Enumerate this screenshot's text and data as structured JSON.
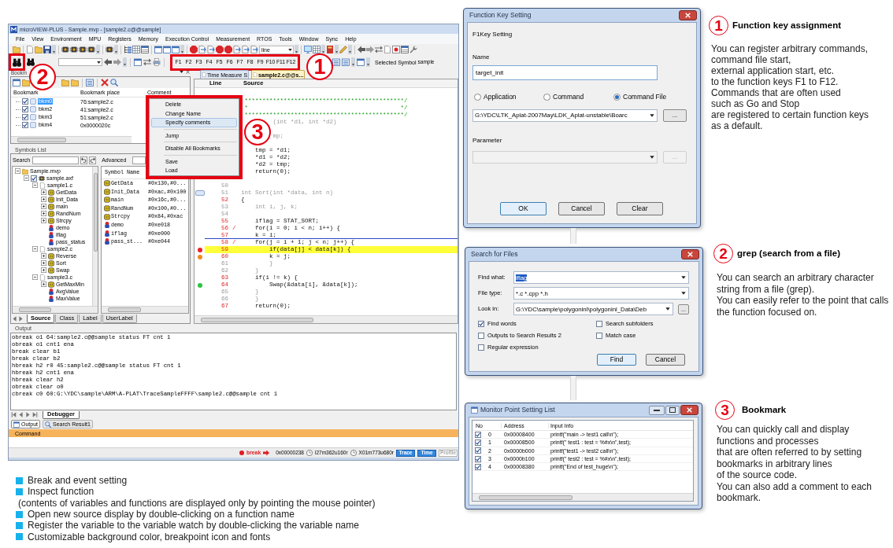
{
  "ide": {
    "title": "microVIEW-PLUS - Sample.mvp - [sample2.c@@sample]",
    "menu": [
      "File",
      "View",
      "Environment",
      "MPU",
      "Registers",
      "Memory",
      "Execution Control",
      "Measurement",
      "RTOS",
      "Tools",
      "Window",
      "Sync",
      "Help"
    ],
    "toolbar": {
      "step_mode": "line",
      "function_keys": [
        "F1",
        "F2",
        "F3",
        "F4",
        "F5",
        "F6",
        "F7",
        "F8",
        "F9",
        "F10",
        "F11",
        "F12"
      ],
      "selected_symbol_label": "Selected Symbol",
      "selected_symbol": "sample"
    },
    "bookmarks": {
      "title": "Bookm",
      "columns": [
        "Bookmark",
        "Bookmark place",
        "Comment"
      ],
      "rows": [
        {
          "name": "bkm0",
          "place": "76:sample2.c",
          "checked": true,
          "selected": true
        },
        {
          "name": "bkm2",
          "place": "41:sample2.c",
          "checked": true,
          "selected": false
        },
        {
          "name": "bkm3",
          "place": "51:sample2.c",
          "checked": true,
          "selected": false
        },
        {
          "name": "bkm4",
          "place": "0x0000020c",
          "checked": true,
          "selected": false
        }
      ]
    },
    "context_menu": [
      {
        "label": "Delete",
        "selected": false,
        "separator_before": false
      },
      {
        "label": "Change Name",
        "selected": false,
        "separator_before": false
      },
      {
        "label": "Specify comments",
        "selected": true,
        "separator_before": false
      },
      {
        "label": "Jump",
        "selected": false,
        "separator_before": true
      },
      {
        "label": "Disable All Bookmarks",
        "selected": false,
        "separator_before": true
      },
      {
        "label": "Save",
        "selected": false,
        "separator_before": true
      },
      {
        "label": "Load",
        "selected": false,
        "separator_before": false
      }
    ],
    "symbols": {
      "title": "Symbols List",
      "search_label": "Search",
      "advanced_label": "Advanced",
      "tree": [
        {
          "label": "Sample.mvp",
          "kind": "project",
          "expanded": true,
          "children": [
            {
              "label": "sample.axf",
              "kind": "program",
              "expanded": true,
              "checked": true,
              "children": [
                {
                  "label": "sample1.c",
                  "kind": "file",
                  "expanded": true,
                  "children": [
                    {
                      "label": "GetData",
                      "kind": "function",
                      "expanded": false
                    },
                    {
                      "label": "Init_Data",
                      "kind": "function",
                      "expanded": false
                    },
                    {
                      "label": "main",
                      "kind": "function",
                      "expanded": false
                    },
                    {
                      "label": "RandNum",
                      "kind": "function",
                      "expanded": false
                    },
                    {
                      "label": "Strcpy",
                      "kind": "function",
                      "expanded": false
                    },
                    {
                      "label": "demo",
                      "kind": "variable"
                    },
                    {
                      "label": "iflag",
                      "kind": "variable"
                    },
                    {
                      "label": "pass_status",
                      "kind": "variable"
                    }
                  ]
                },
                {
                  "label": "sample2.c",
                  "kind": "file",
                  "expanded": true,
                  "children": [
                    {
                      "label": "Reverse",
                      "kind": "function",
                      "expanded": false
                    },
                    {
                      "label": "Sort",
                      "kind": "function",
                      "expanded": false
                    },
                    {
                      "label": "Swap",
                      "kind": "function",
                      "expanded": false
                    }
                  ]
                },
                {
                  "label": "sample3.c",
                  "kind": "file",
                  "expanded": true,
                  "children": [
                    {
                      "label": "GetMaxMin",
                      "kind": "function",
                      "expanded": false
                    },
                    {
                      "label": "AvgValue",
                      "kind": "variable"
                    },
                    {
                      "label": "MaxValue",
                      "kind": "variable"
                    }
                  ]
                }
              ]
            }
          ]
        }
      ],
      "table": {
        "columns": [
          "Symbol Name"
        ],
        "rows": [
          {
            "kind": "function",
            "name": "GetData",
            "value": "#0x130,#0..."
          },
          {
            "kind": "function",
            "name": "Init_Data",
            "value": "#0xac,#0x100"
          },
          {
            "kind": "function",
            "name": "main",
            "value": "#0x16c,#0..."
          },
          {
            "kind": "function",
            "name": "RandNum",
            "value": "#0x100,#0..."
          },
          {
            "kind": "function",
            "name": "Strcpy",
            "value": "#0x84,#0xac"
          },
          {
            "kind": "variable",
            "name": "demo",
            "value": "#0xe018"
          },
          {
            "kind": "variable",
            "name": "iflag",
            "value": "#0xe000"
          },
          {
            "kind": "variable",
            "name": "pass_st...",
            "value": "#0xe044"
          }
        ]
      },
      "tabs": [
        {
          "label": "Source",
          "selected": true
        },
        {
          "label": "Class",
          "selected": false
        },
        {
          "label": "Label",
          "selected": false
        },
        {
          "label": "UserLabel",
          "selected": false
        }
      ]
    },
    "editor": {
      "tabs": [
        {
          "label": "Time Measure S",
          "selected": false
        },
        {
          "label": "sample2.c@@s...",
          "selected": true
        }
      ],
      "columns": [
        "Line",
        "Source"
      ],
      "lines": [
        {
          "kind": "comment",
          "code": " *********************************************/"
        },
        {
          "kind": "comment",
          "code": " *                                           */"
        },
        {
          "kind": "comment",
          "code": " *********************************************/"
        },
        {
          "kind": "code",
          "executable": false,
          "highlighted": false,
          "cursor": false,
          "code": "         (int *d1, int *d2)"
        },
        {
          "kind": "blank"
        },
        {
          "kind": "code",
          "executable": false,
          "highlighted": false,
          "cursor": false,
          "code": "         mp;"
        },
        {
          "kind": "blank"
        },
        {
          "kind": "code",
          "executable": true,
          "highlighted": false,
          "cursor": false,
          "code": "    tmp = *d1;"
        },
        {
          "kind": "code",
          "executable": true,
          "highlighted": false,
          "cursor": false,
          "code": "    *d1 = *d2;"
        },
        {
          "kind": "code",
          "executable": true,
          "highlighted": false,
          "cursor": false,
          "code": "    *d2 = tmp;"
        },
        {
          "kind": "code",
          "executable": true,
          "highlighted": false,
          "cursor": false,
          "code": "    return(0);"
        },
        {
          "kind": "blank"
        },
        {
          "kind": "code",
          "number": "50",
          "executable": false,
          "highlighted": false,
          "cursor": false
        },
        {
          "kind": "code",
          "number": "51",
          "executable": false,
          "highlighted": false,
          "cursor": false,
          "code": "int Sort(int *data, int n)",
          "marker": {
            "kind": "bookmark"
          }
        },
        {
          "kind": "code",
          "number": "52",
          "executable": true,
          "highlighted": false,
          "cursor": false,
          "code": "{"
        },
        {
          "kind": "code",
          "number": "53",
          "executable": false,
          "highlighted": false,
          "cursor": false,
          "code": "    int i, j, k;"
        },
        {
          "kind": "code",
          "number": "54",
          "executable": false,
          "highlighted": false,
          "cursor": false
        },
        {
          "kind": "code",
          "number": "55",
          "executable": true,
          "highlighted": false,
          "cursor": false,
          "code": "    iflag = STAT_SORT;"
        },
        {
          "kind": "code",
          "number": "56",
          "executable": true,
          "highlighted": false,
          "cursor": false,
          "branch": "/",
          "code": "    for(i = 0; i < n; i++) {"
        },
        {
          "kind": "code",
          "number": "57",
          "executable": true,
          "highlighted": false,
          "cursor": true,
          "code": "    k = i;"
        },
        {
          "kind": "code",
          "number": "58",
          "executable": true,
          "highlighted": false,
          "cursor": false,
          "branch": "/",
          "code": "    for(j = i + 1; j < n; j++) {"
        },
        {
          "kind": "code",
          "number": "59",
          "executable": true,
          "highlighted": true,
          "cursor": false,
          "code": "        if(data[j] < data[k]) {",
          "marker": {
            "kind": "dot",
            "color": "#e8232a"
          }
        },
        {
          "kind": "code",
          "number": "60",
          "executable": true,
          "highlighted": false,
          "cursor": false,
          "code": "        k = j;",
          "marker": {
            "kind": "dot",
            "color": "#f08a1e"
          }
        },
        {
          "kind": "code",
          "number": "61",
          "executable": false,
          "highlighted": false,
          "cursor": false,
          "code": "        }"
        },
        {
          "kind": "code",
          "number": "62",
          "executable": false,
          "highlighted": false,
          "cursor": false,
          "code": "    }"
        },
        {
          "kind": "code",
          "number": "63",
          "executable": true,
          "highlighted": false,
          "cursor": false,
          "code": "    if(i != k) {"
        },
        {
          "kind": "code",
          "number": "64",
          "executable": true,
          "highlighted": false,
          "cursor": false,
          "code": "        Swap(&data[i], &data[k]);",
          "marker": {
            "kind": "dot",
            "color": "#2fc43f"
          }
        },
        {
          "kind": "code",
          "number": "65",
          "executable": false,
          "highlighted": false,
          "cursor": false,
          "code": "    }"
        },
        {
          "kind": "code",
          "number": "66",
          "executable": false,
          "highlighted": false,
          "cursor": false,
          "code": "    }"
        },
        {
          "kind": "code",
          "number": "67",
          "executable": true,
          "highlighted": false,
          "cursor": false,
          "code": "    return(0);"
        }
      ]
    },
    "output": {
      "title": "Output",
      "lines": [
        "obreak o1 64:sample2.c@@sample status FT cnt 1",
        "obreak o1 cnt1 ena",
        "break clear b1",
        "break clear b2",
        "hbreak h2 r0 45:sample2.c@@sample status FT cnt 1",
        "hbreak h2 cnt1 ena",
        "hbreak clear h2",
        "obreak clear o0",
        "cbreak c0 60:G:\\YDC\\sample\\ARM\\A-PLAT\\TraceSampleFFFF\\sample2.c@@sample cnt 1"
      ],
      "tabs": [
        {
          "label": "Debugger",
          "selected": true
        }
      ]
    },
    "panel_tabs": [
      {
        "label": "Output",
        "selected": true
      },
      {
        "label": "Search Result1",
        "selected": false
      }
    ],
    "command": {
      "title": "Command"
    },
    "status": {
      "break_label": "break",
      "address": "0x00000238",
      "timer_1": "l27m362u160r",
      "timer_2": "X01m773u680r",
      "badges": [
        {
          "label": "Trace",
          "on": true
        },
        {
          "label": "Time",
          "on": true
        },
        {
          "label": "Profile",
          "on": false
        }
      ]
    }
  },
  "callouts": [
    "1",
    "2",
    "3"
  ],
  "function_key_dialog": {
    "title": "Function Key Setting",
    "heading": "F1Key Setting",
    "name_label": "Name",
    "name_value": "target_init",
    "types": [
      {
        "label": "Application",
        "selected": false
      },
      {
        "label": "Command",
        "selected": false
      },
      {
        "label": "Command File",
        "selected": true
      }
    ],
    "path_value": "G:\\YDC\\LTK_Aplat-2007May\\LDK_Aplat-unstable\\Boarc",
    "path_browse": "...",
    "parameter_label": "Parameter",
    "parameter_disabled": true,
    "parameter_browse": "...",
    "buttons": [
      {
        "label": "OK",
        "default": true
      },
      {
        "label": "Cancel",
        "default": false
      },
      {
        "label": "Clear",
        "default": false
      }
    ]
  },
  "search_dialog": {
    "title": "Search for Files",
    "fields": [
      {
        "label": "Find what:",
        "value": "iflag",
        "highlighted": true
      },
      {
        "label": "File type:",
        "value": "*.c *.cpp *.h",
        "highlighted": false
      },
      {
        "label": "Look in:",
        "value": "G:\\YDC\\sample\\polygoninl\\polygoninl_Data\\Deb",
        "highlighted": false,
        "browse": "..."
      }
    ],
    "options": [
      {
        "label": "Find words",
        "checked": true
      },
      {
        "label": "Search subfolders",
        "checked": false
      },
      {
        "label": "Outputs to Search Results 2",
        "checked": false
      },
      {
        "label": "Match case",
        "checked": false
      },
      {
        "label": "Regular expression",
        "checked": false
      }
    ],
    "buttons": [
      {
        "label": "Find",
        "default": true
      },
      {
        "label": "Cancel",
        "default": false
      }
    ]
  },
  "monitor_window": {
    "title": "Monitor Point Setting List",
    "columns": [
      "No",
      "Address",
      "Input Info"
    ],
    "rows": [
      {
        "checked": true,
        "no": "0",
        "address": "0x00008400",
        "info": "printf(\"main -> test1 call\\n\");"
      },
      {
        "checked": true,
        "no": "1",
        "address": "0x00008500",
        "info": "printf(\" test1 : test = %#x\\n\",test);"
      },
      {
        "checked": true,
        "no": "2",
        "address": "0x0000b000",
        "info": "printf(\"test1 -> test2 call\\n\");"
      },
      {
        "checked": true,
        "no": "3",
        "address": "0x0000b100",
        "info": "printf(\" test2 : test = %#x\\n\",test);"
      },
      {
        "checked": true,
        "no": "4",
        "address": "0x00008380",
        "info": "printf(\"End of test_huge\\n\");"
      }
    ]
  },
  "features": [
    {
      "number": "1",
      "heading": "Function key assignment",
      "lines": [
        "You can register arbitrary commands,",
        "command file start,",
        "external application start, etc.",
        "to the function keys F1 to F12.",
        "Commands that are often used",
        "such as Go and Stop",
        "are registered to certain function keys",
        "as a default."
      ]
    },
    {
      "number": "2",
      "heading": "grep (search from a file)",
      "lines": [
        "You can search an arbitrary character",
        "string from a file (grep).",
        "You can easily refer to the point that calls",
        "the function focused on."
      ]
    },
    {
      "number": "3",
      "heading": "Bookmark",
      "lines": [
        "You can quickly call and display",
        "functions and processes",
        "that are often referred to by setting",
        "bookmarks in arbitrary lines",
        "of the source code.",
        "You can also add a comment to each",
        "bookmark."
      ]
    }
  ],
  "highlights": [
    {
      "kind": "bullet",
      "text": "Break and event setting"
    },
    {
      "kind": "bullet",
      "text": "Inspect function"
    },
    {
      "kind": "note",
      "text": "(contents of variables and functions are displayed only by pointing the mouse pointer)"
    },
    {
      "kind": "bullet",
      "text": "Open new source display by double-clicking on a function name"
    },
    {
      "kind": "bullet",
      "text": "Register the variable to the variable watch by double-clicking the variable name"
    },
    {
      "kind": "bullet",
      "text": "Customizable background color, breakpoint icon and fonts"
    }
  ]
}
